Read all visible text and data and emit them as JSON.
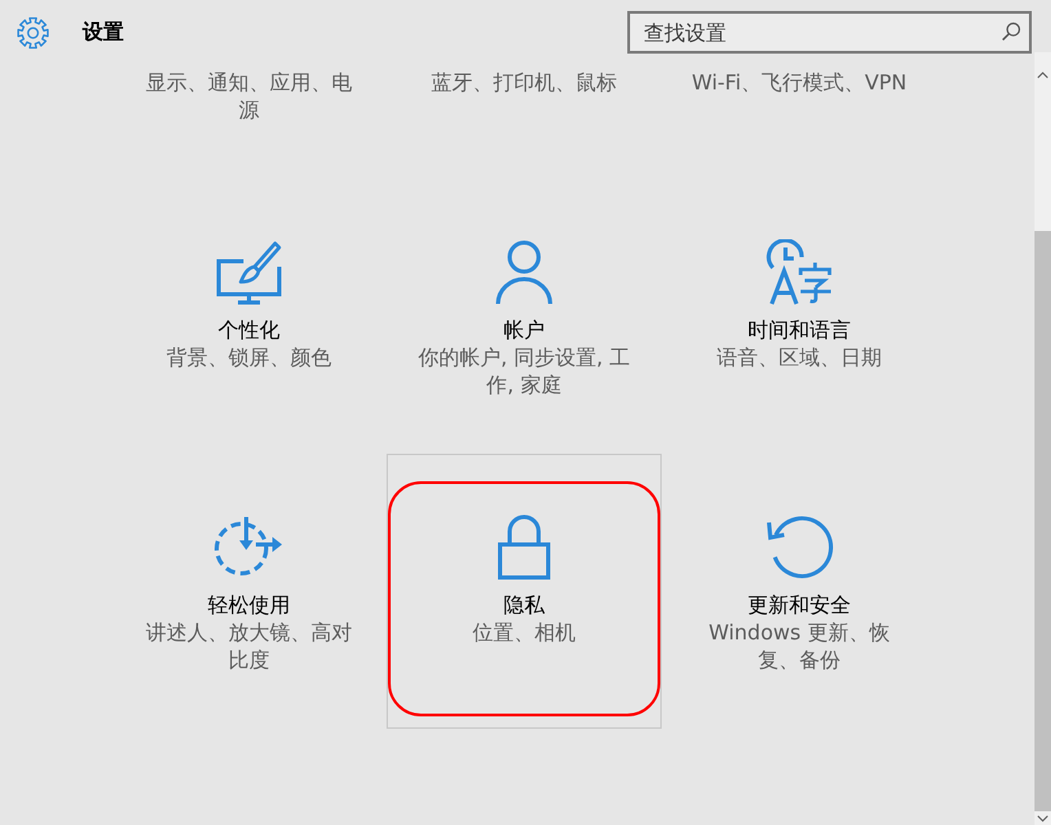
{
  "header": {
    "title": "设置",
    "search": {
      "placeholder": "查找设置"
    }
  },
  "categories": [
    {
      "kind": "cut",
      "description": "显示、通知、应用、电源",
      "hovered": false,
      "circled": false
    },
    {
      "kind": "cut",
      "description": "蓝牙、打印机、鼠标",
      "hovered": false,
      "circled": false
    },
    {
      "kind": "cut",
      "description": "Wi-Fi、飞行模式、VPN",
      "hovered": false,
      "circled": false
    },
    {
      "kind": "full",
      "title": "个性化",
      "description": "背景、锁屏、颜色",
      "hovered": false,
      "circled": false
    },
    {
      "kind": "full",
      "title": "帐户",
      "description": "你的帐户, 同步设置, 工作, 家庭",
      "hovered": false,
      "circled": false
    },
    {
      "kind": "full",
      "title": "时间和语言",
      "description": "语音、区域、日期",
      "hovered": false,
      "circled": false
    },
    {
      "kind": "full",
      "title": "轻松使用",
      "description": "讲述人、放大镜、高对比度",
      "hovered": false,
      "circled": false
    },
    {
      "kind": "full",
      "title": "隐私",
      "description": "位置、相机",
      "hovered": true,
      "circled": true
    },
    {
      "kind": "full",
      "title": "更新和安全",
      "description": "Windows 更新、恢复、备份",
      "hovered": false,
      "circled": false
    }
  ]
}
